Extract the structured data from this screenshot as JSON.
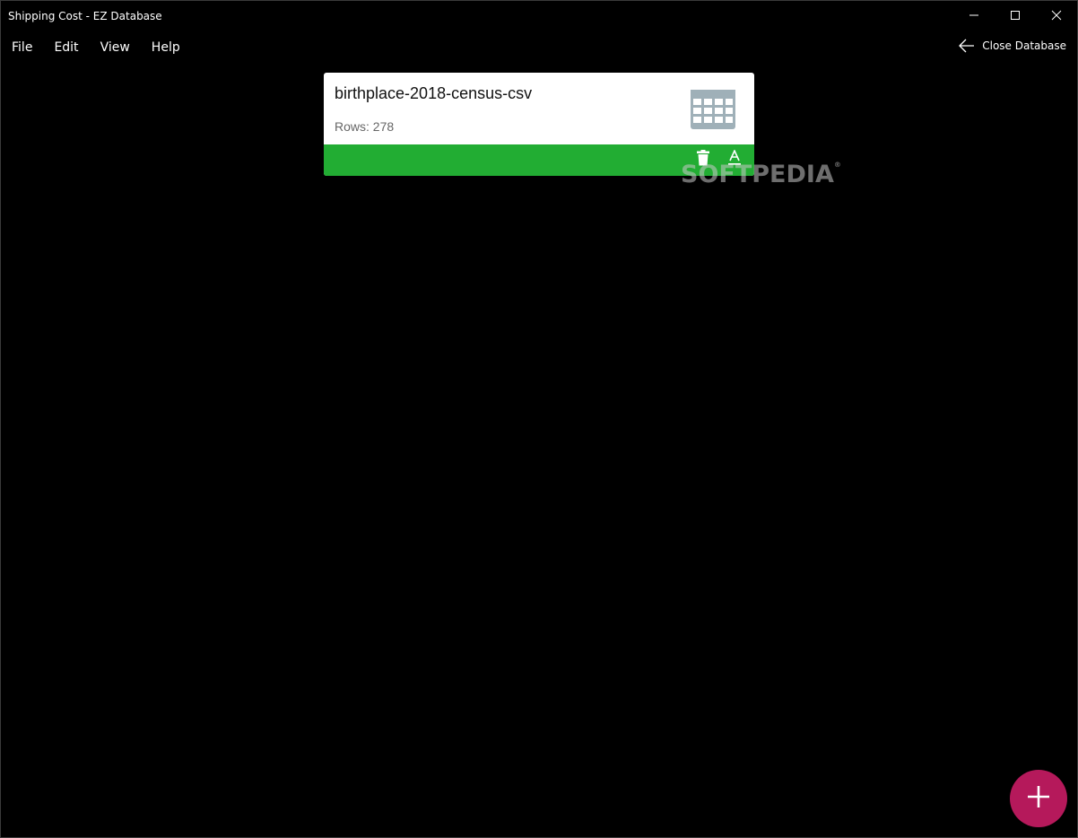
{
  "window": {
    "title": "Shipping Cost - EZ Database"
  },
  "menu": {
    "items": [
      "File",
      "Edit",
      "View",
      "Help"
    ]
  },
  "header": {
    "close_database_label": "Close Database"
  },
  "tables": [
    {
      "name": "birthplace-2018-census-csv",
      "rows_text": "Rows: 278"
    }
  ],
  "watermark": {
    "text": "SOFTPEDIA",
    "mark": "®"
  },
  "colors": {
    "background": "#000000",
    "card_bar": "#22ad33",
    "fab": "#b5195b",
    "table_icon": "#9fb0b8"
  },
  "icons": {
    "minimize": "minimize-icon",
    "maximize": "maximize-icon",
    "close": "close-icon",
    "back": "arrow-left-icon",
    "table": "table-grid-icon",
    "delete": "trash-icon",
    "rename": "rename-text-icon",
    "add": "plus-icon"
  }
}
